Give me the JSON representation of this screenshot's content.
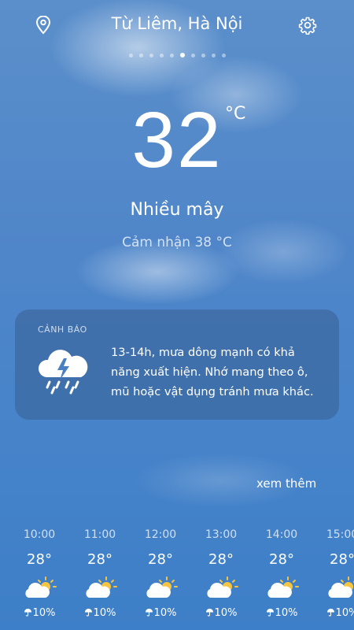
{
  "header": {
    "location": "Từ Liêm, Hà Nội",
    "page_count": 10,
    "active_page": 5
  },
  "current": {
    "temperature": "32",
    "unit": "°C",
    "condition": "Nhiều mây",
    "feels_like": "Cảm nhận 38 °C"
  },
  "alert": {
    "title": "CẢNH BÁO",
    "icon": "thunderstorm-icon",
    "message": "13-14h, mưa dông mạnh có khả năng xuất hiện. Nhớ mang theo ô, mũ hoặc vật dụng tránh mưa khác."
  },
  "more_link": "xem thêm",
  "hourly": [
    {
      "time": "10:00",
      "temp": "28°",
      "icon": "partly-cloudy-icon",
      "rain": "10%"
    },
    {
      "time": "11:00",
      "temp": "28°",
      "icon": "partly-cloudy-icon",
      "rain": "10%"
    },
    {
      "time": "12:00",
      "temp": "28°",
      "icon": "partly-cloudy-icon",
      "rain": "10%"
    },
    {
      "time": "13:00",
      "temp": "28°",
      "icon": "partly-cloudy-icon",
      "rain": "10%"
    },
    {
      "time": "14:00",
      "temp": "28°",
      "icon": "partly-cloudy-icon",
      "rain": "10%"
    },
    {
      "time": "15:00",
      "temp": "28°",
      "icon": "partly-cloudy-icon",
      "rain": "10%"
    }
  ],
  "colors": {
    "sky": "#4683c9",
    "sun": "#f5c542",
    "alert_bg": "#2e4a73"
  }
}
